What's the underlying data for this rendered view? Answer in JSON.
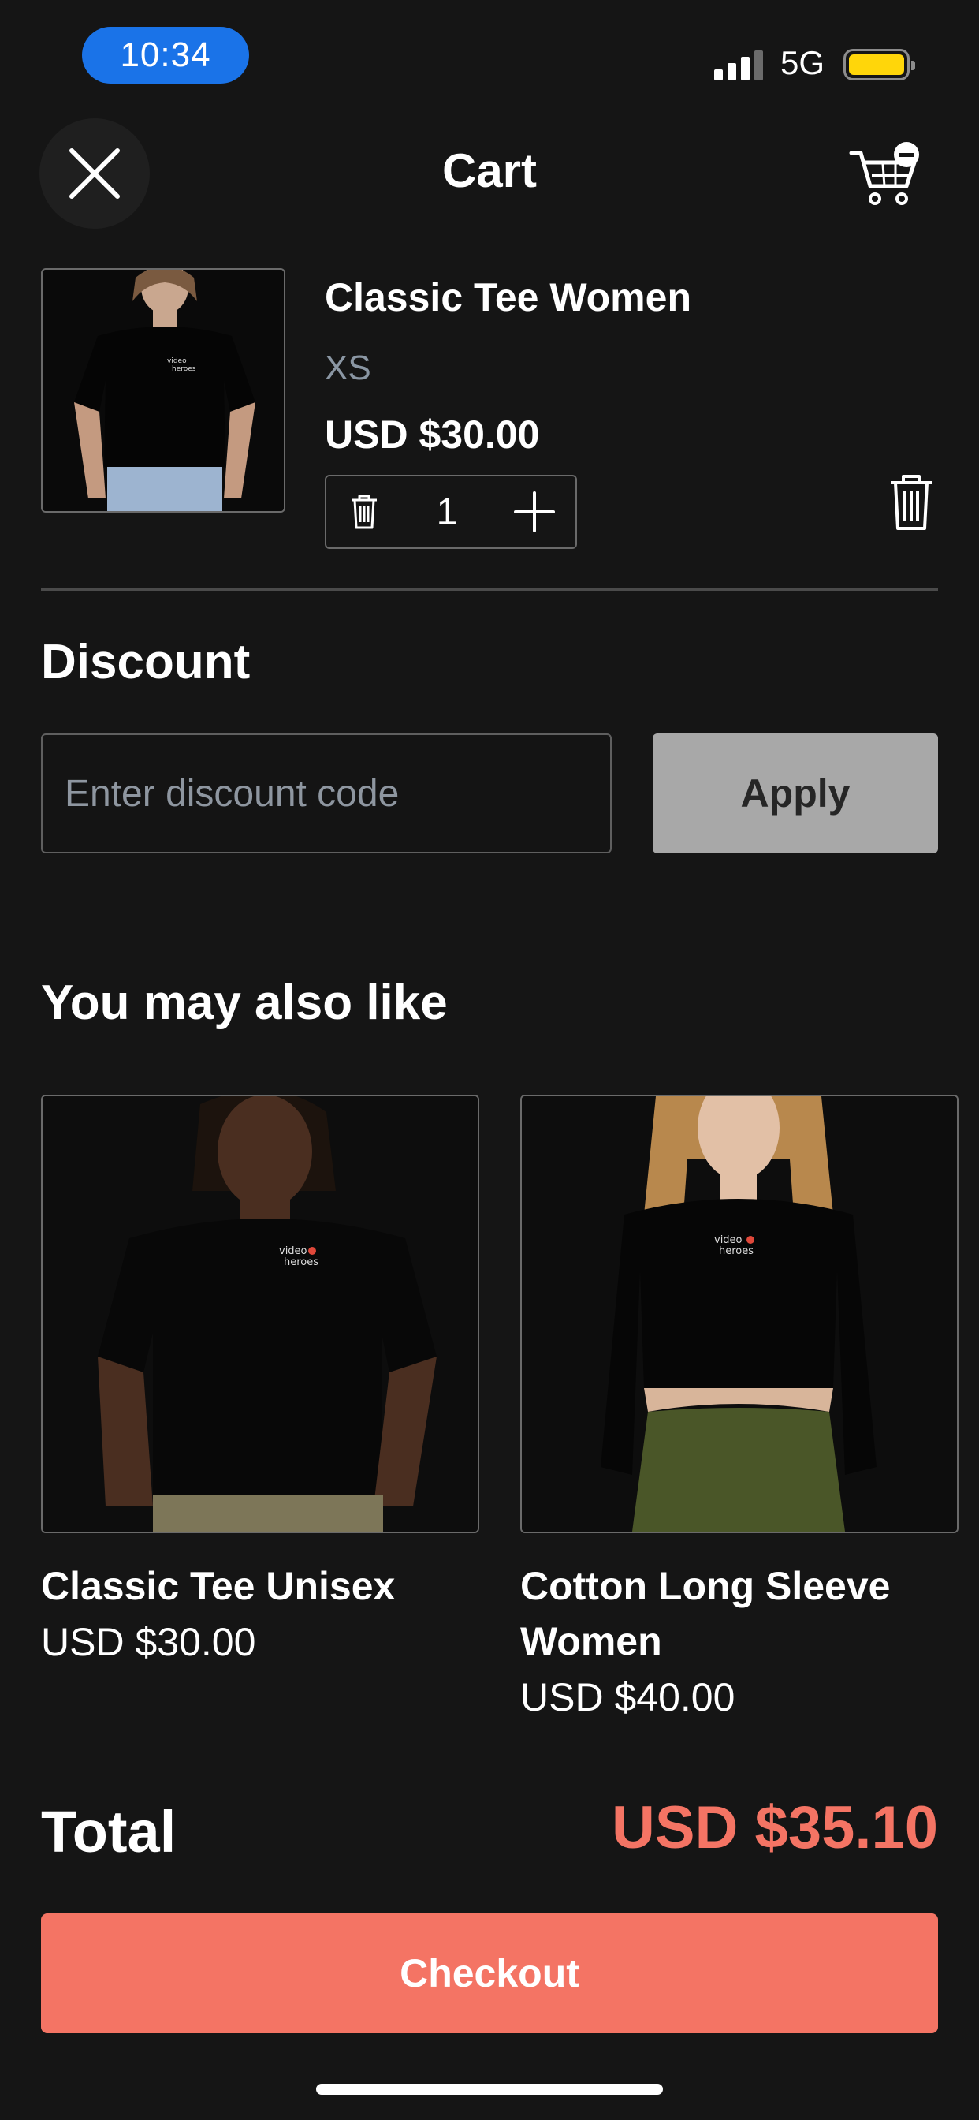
{
  "status_bar": {
    "time": "10:34",
    "network": "5G",
    "signal_bars_active": 3,
    "signal_bars_total": 4
  },
  "header": {
    "title": "Cart",
    "close_icon": "close-icon",
    "cart_icon": "cart-remove-icon"
  },
  "cart_items": [
    {
      "name": "Classic Tee Women",
      "variant": "XS",
      "price": "USD $30.00",
      "quantity": "1"
    }
  ],
  "discount": {
    "heading": "Discount",
    "placeholder": "Enter discount code",
    "apply_label": "Apply"
  },
  "recommendations": {
    "heading": "You may also like",
    "items": [
      {
        "name": "Classic Tee Unisex",
        "price": "USD $30.00"
      },
      {
        "name": "Cotton Long Sleeve Women",
        "price": "USD $40.00"
      }
    ]
  },
  "total": {
    "label": "Total",
    "value": "USD $35.10"
  },
  "checkout": {
    "label": "Checkout"
  },
  "colors": {
    "accent": "#f47464",
    "status_time_pill": "#1a73e8",
    "apply_button": "#a8a8a8",
    "battery": "#ffd60a"
  }
}
